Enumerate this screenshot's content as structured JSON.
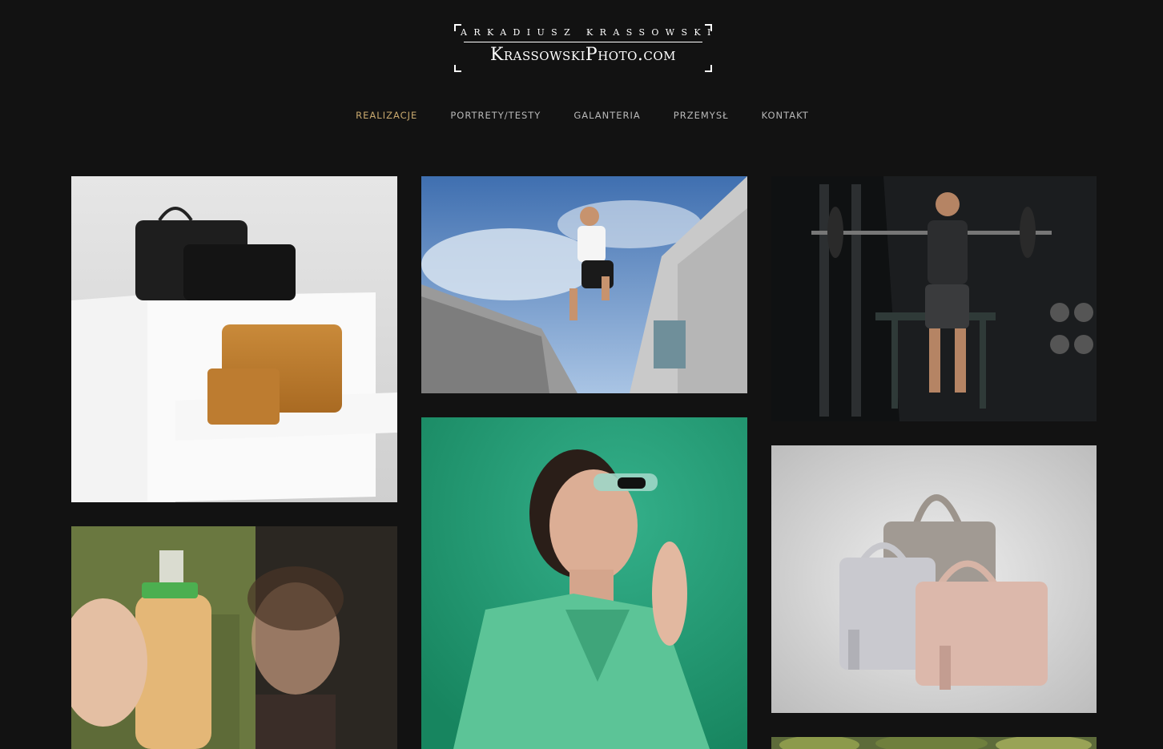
{
  "logo": {
    "name": "ARKADIUSZ KRASSOWSKI",
    "site": "KrassowskiPhoto.com"
  },
  "nav": {
    "items": [
      {
        "label": "REALIZACJE",
        "active": true
      },
      {
        "label": "PORTRETY/TESTY",
        "active": false
      },
      {
        "label": "GALANTERIA",
        "active": false
      },
      {
        "label": "PRZEMYSŁ",
        "active": false
      },
      {
        "label": "KONTAKT",
        "active": false
      }
    ],
    "active_color": "#c9a96e",
    "text_color": "#b8b8b8"
  },
  "colors": {
    "background": "#121212"
  },
  "gallery": {
    "photos": [
      {
        "subject": "black and brown leather bags on white shelves"
      },
      {
        "subject": "man jumping between buildings against blue sky"
      },
      {
        "subject": "athlete holding barbell in dark gym"
      },
      {
        "subject": "woman holding juice bottle"
      },
      {
        "subject": "woman with sunglasses on green background"
      },
      {
        "subject": "grey and pink handbags on grey background"
      },
      {
        "subject": "partial photo with greenery"
      }
    ]
  }
}
